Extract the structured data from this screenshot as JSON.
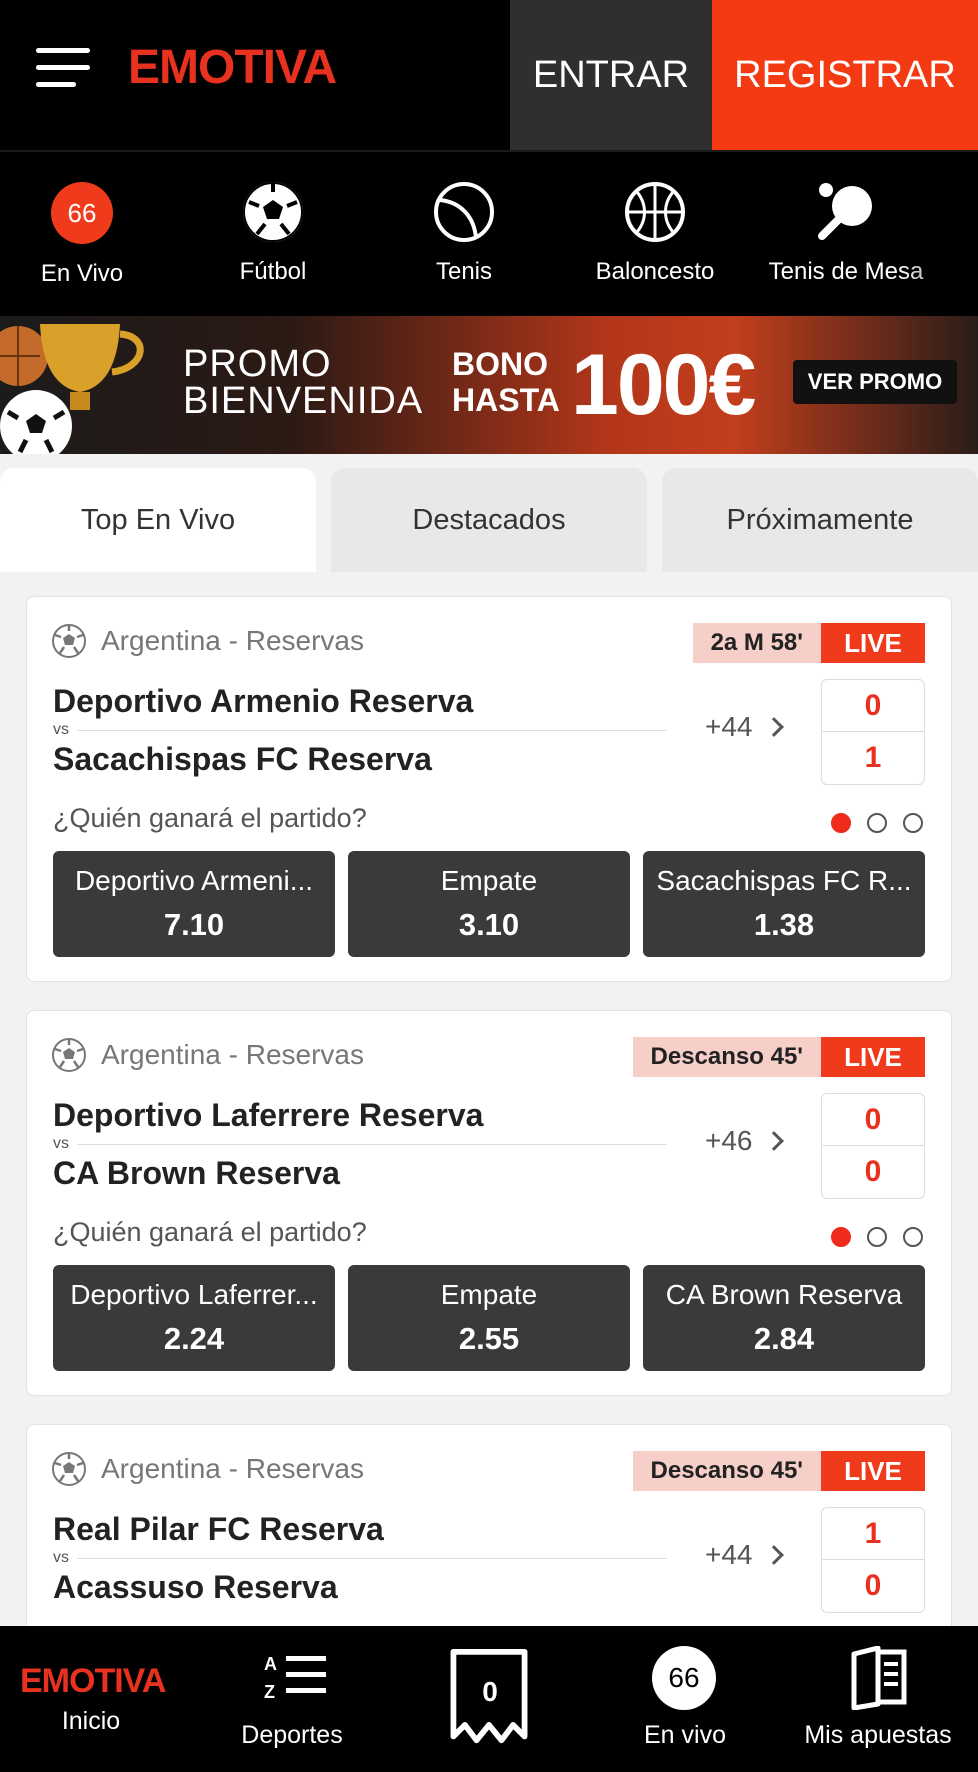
{
  "header": {
    "logo": "EMOTIVA",
    "login_label": "ENTRAR",
    "register_label": "REGISTRAR"
  },
  "sports": [
    {
      "label": "En Vivo",
      "badge": "66",
      "icon": "live-count-icon"
    },
    {
      "label": "Fútbol",
      "icon": "soccer-ball-icon"
    },
    {
      "label": "Tenis",
      "icon": "tennis-ball-icon"
    },
    {
      "label": "Baloncesto",
      "icon": "basketball-icon"
    },
    {
      "label": "Tenis de Mesa",
      "icon": "table-tennis-icon"
    }
  ],
  "promo": {
    "line1": "PROMO",
    "line2": "BIENVENIDA",
    "bono1": "BONO",
    "bono2": "HASTA",
    "amount": "100€",
    "button": "VER PROMO"
  },
  "tabs": [
    "Top En Vivo",
    "Destacados",
    "Próximamente"
  ],
  "matches": [
    {
      "league": "Argentina - Reservas",
      "time": "2a M 58'",
      "live": "LIVE",
      "team1": "Deportivo Armenio Reserva",
      "team2": "Sacachispas FC Reserva",
      "vs": "vs",
      "more": "+44",
      "score1": "0",
      "score2": "1",
      "question": "¿Quién ganará el partido?",
      "odds": [
        {
          "label": "Deportivo Armeni...",
          "value": "7.10"
        },
        {
          "label": "Empate",
          "value": "3.10"
        },
        {
          "label": "Sacachispas FC R...",
          "value": "1.38"
        }
      ]
    },
    {
      "league": "Argentina - Reservas",
      "time": "Descanso 45'",
      "live": "LIVE",
      "team1": "Deportivo Laferrere Reserva",
      "team2": "CA Brown Reserva",
      "vs": "vs",
      "more": "+46",
      "score1": "0",
      "score2": "0",
      "question": "¿Quién ganará el partido?",
      "odds": [
        {
          "label": "Deportivo Laferrer...",
          "value": "2.24"
        },
        {
          "label": "Empate",
          "value": "2.55"
        },
        {
          "label": "CA Brown Reserva",
          "value": "2.84"
        }
      ]
    },
    {
      "league": "Argentina - Reservas",
      "time": "Descanso 45'",
      "live": "LIVE",
      "team1": "Real Pilar FC Reserva",
      "team2": "Acassuso Reserva",
      "vs": "vs",
      "more": "+44",
      "score1": "1",
      "score2": "0"
    }
  ],
  "bottom_nav": [
    {
      "label": "Inicio",
      "logo": "EMOTIVA"
    },
    {
      "label": "Deportes",
      "icon": "az-list-icon"
    },
    {
      "label": "",
      "ticket_count": "0",
      "icon": "bet-slip-icon"
    },
    {
      "label": "En vivo",
      "badge": "66"
    },
    {
      "label": "Mis apuestas",
      "icon": "my-bets-book-icon"
    }
  ],
  "colors": {
    "brand": "#e8321f",
    "register_bg": "#f33a12",
    "odds_bg": "#3a3a3a",
    "live_bg": "#ef3b1b"
  }
}
